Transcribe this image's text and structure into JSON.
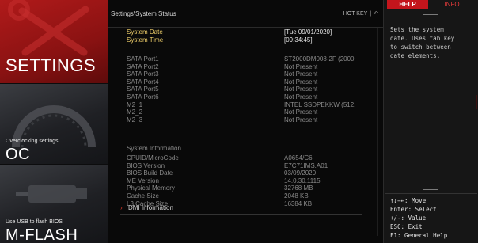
{
  "sidebar": {
    "settings": {
      "label": "SETTINGS"
    },
    "oc": {
      "caption": "Overclocking settings",
      "label": "OC"
    },
    "mflash": {
      "caption": "Use USB to flash BIOS",
      "label": "M-FLASH"
    }
  },
  "header": {
    "breadcrumb": "Settings\\System Status",
    "hotkey_label": "HOT KEY",
    "separator": "|",
    "back_glyph": "↶"
  },
  "system": {
    "date_label": "System Date",
    "date_value": "[Tue  09/01/2020]",
    "time_label": "System Time",
    "time_value": "[09:34:45]"
  },
  "ports": [
    {
      "label": "SATA Port1",
      "value": "ST2000DM008-2F (2000"
    },
    {
      "label": "SATA Port2",
      "value": "Not Present"
    },
    {
      "label": "SATA Port3",
      "value": "Not Present"
    },
    {
      "label": "SATA Port4",
      "value": "Not Present"
    },
    {
      "label": "SATA Port5",
      "value": "Not Present"
    },
    {
      "label": "SATA Port6",
      "value": "Not Present"
    },
    {
      "label": "M2_1",
      "value": "INTEL SSDPEKKW (512."
    },
    {
      "label": "M2_2",
      "value": "Not Present"
    },
    {
      "label": "M2_3",
      "value": "Not Present"
    }
  ],
  "info": {
    "heading": "System Information",
    "items": [
      {
        "label": "CPUID/MicroCode",
        "value": "A0654/C6"
      },
      {
        "label": "BIOS Version",
        "value": "E7C71IMS.A01"
      },
      {
        "label": "BIOS Build Date",
        "value": "03/09/2020"
      },
      {
        "label": "ME Version",
        "value": "14.0.30.1115"
      },
      {
        "label": "Physical Memory",
        "value": "32768 MB"
      },
      {
        "label": "Cache Size",
        "value": "2048 KB"
      },
      {
        "label": "L3 Cache Size",
        "value": "16384 KB"
      }
    ]
  },
  "dmi": {
    "arrow": "›",
    "label": "DMI Information"
  },
  "help_panel": {
    "tab_help": "HELP",
    "tab_info": "INFO",
    "text_lines": [
      "Sets the system",
      "date.  Uses tab key",
      "to switch between",
      "date elements."
    ],
    "keys": [
      "↑↓→←: Move",
      "Enter: Select",
      "+/-: Value",
      "ESC: Exit",
      "F1: General Help"
    ]
  },
  "colors": {
    "accent": "#c4151c",
    "highlight": "#f2d16b",
    "dim": "#8a8a8a"
  }
}
